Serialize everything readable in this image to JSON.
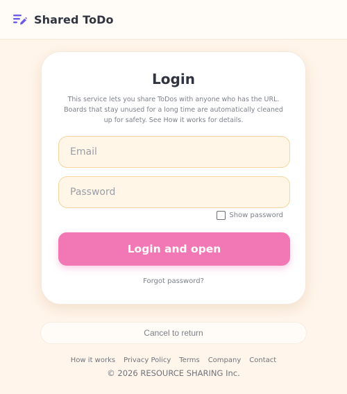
{
  "header": {
    "brand": "Shared ToDo",
    "logo_icon": "list-edit-icon",
    "accent_color": "#6b5ce7"
  },
  "login_card": {
    "title": "Login",
    "description": "This service lets you share ToDos with anyone who has the URL. Boards that stay unused for a long time are automatically cleaned up for safety. See How it works for details.",
    "email": {
      "value": "",
      "placeholder": "Email"
    },
    "password": {
      "value": "",
      "placeholder": "Password"
    },
    "show_password": {
      "label": "Show password",
      "checked": false
    },
    "submit_label": "Login and open",
    "submit_color": "#f277b5",
    "forgot_label": "Forgot password?"
  },
  "cancel_label": "Cancel to return",
  "footer": {
    "links": [
      "How it works",
      "Privacy Policy",
      "Terms",
      "Company",
      "Contact"
    ],
    "copyright": "© 2026 RESOURCE SHARING Inc."
  }
}
